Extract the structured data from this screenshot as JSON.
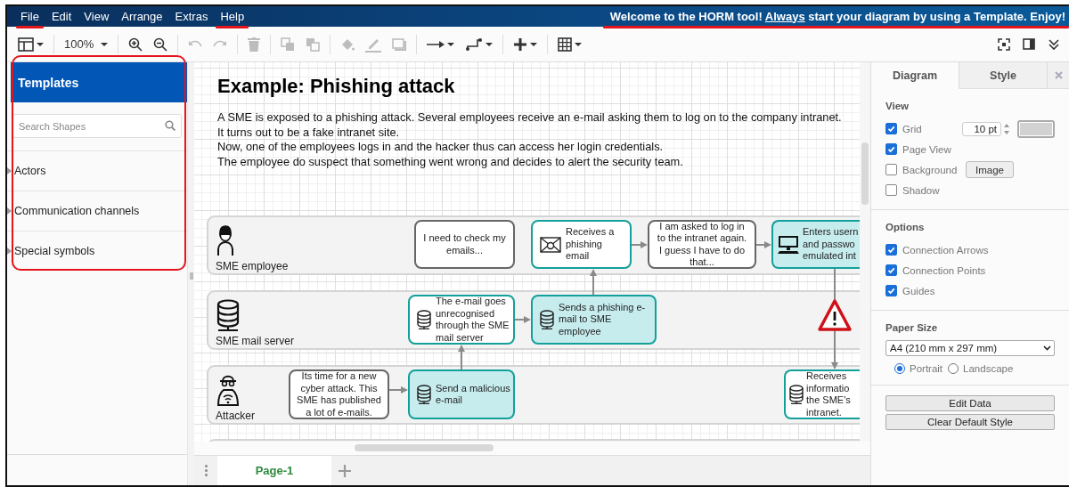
{
  "menubar": {
    "items": [
      {
        "label": "File",
        "highlighted": true
      },
      {
        "label": "Edit",
        "highlighted": false
      },
      {
        "label": "View",
        "highlighted": false
      },
      {
        "label": "Arrange",
        "highlighted": false
      },
      {
        "label": "Extras",
        "highlighted": false
      },
      {
        "label": "Help",
        "highlighted": true
      }
    ],
    "welcome": {
      "text_before": "Welcome to the HORM tool! ",
      "link": "Always",
      "text_after": " start your diagram by using a Template. Enjoy!",
      "highlighted": true
    }
  },
  "toolbar": {
    "groups": [
      [
        {
          "kind": "format",
          "dropdown": true,
          "disabled": false
        }
      ],
      [
        {
          "kind": "zoom",
          "label": "100%",
          "dropdown": true,
          "disabled": false
        }
      ],
      [
        {
          "kind": "zoom_in",
          "dropdown": false,
          "disabled": false
        },
        {
          "kind": "zoom_out",
          "dropdown": false,
          "disabled": false
        }
      ],
      [
        {
          "kind": "undo",
          "dropdown": false,
          "disabled": true
        },
        {
          "kind": "redo",
          "dropdown": false,
          "disabled": true
        }
      ],
      [
        {
          "kind": "delete",
          "dropdown": false,
          "disabled": true
        }
      ],
      [
        {
          "kind": "to_front",
          "dropdown": false,
          "disabled": true
        },
        {
          "kind": "to_back",
          "dropdown": false,
          "disabled": true
        }
      ],
      [
        {
          "kind": "fill",
          "dropdown": false,
          "disabled": true
        },
        {
          "kind": "line",
          "dropdown": false,
          "disabled": true
        },
        {
          "kind": "shadow",
          "dropdown": false,
          "disabled": true
        }
      ],
      [
        {
          "kind": "connection",
          "dropdown": true,
          "disabled": false
        },
        {
          "kind": "waypoints",
          "dropdown": true,
          "disabled": false
        }
      ],
      [
        {
          "kind": "insert",
          "dropdown": true,
          "disabled": false
        }
      ],
      [
        {
          "kind": "table",
          "dropdown": true,
          "disabled": false
        }
      ]
    ],
    "right": [
      {
        "kind": "fullscreen",
        "dropdown": false,
        "disabled": false
      },
      {
        "kind": "panel",
        "dropdown": false,
        "disabled": false
      },
      {
        "kind": "collapse",
        "dropdown": false,
        "disabled": false
      }
    ]
  },
  "sidebar": {
    "title": "Templates",
    "highlighted": true,
    "search": {
      "placeholder": "Search Shapes"
    },
    "sections": [
      {
        "label": "Actors",
        "expanded": false
      },
      {
        "label": "Communication channels",
        "expanded": false
      },
      {
        "label": "Special symbols",
        "expanded": false
      }
    ]
  },
  "diagram": {
    "title": "Example: Phishing attack",
    "description": "A SME is exposed to a phishing attack. Several employees receive an e-mail asking them to log on to the company intranet.\nIt turns out to be a fake intranet site.\nNow, one of the employees logs in and the hacker thus can access her login credentials.\nThe employee do suspect that something went wrong and decides to alert the security team.",
    "lanes": [
      {
        "label": "SME employee"
      },
      {
        "label": "SME mail server"
      },
      {
        "label": "Attacker"
      }
    ],
    "nodes": [
      {
        "kind": "note",
        "filled": false,
        "text": "I need to check my emails..."
      },
      {
        "kind": "message",
        "filled": false,
        "text": "Receives a phishing email"
      },
      {
        "kind": "note",
        "filled": false,
        "text": "I am asked to log in to the intranet again. I guess I have to do that..."
      },
      {
        "kind": "computer",
        "filled": true,
        "text": "Enters usern\nand passwo\nemulated int"
      },
      {
        "kind": "server",
        "filled": false,
        "text": "The e-mail goes unrecognised through the SME mail server"
      },
      {
        "kind": "server",
        "filled": true,
        "text": "Sends a phishing e-mail to SME employee"
      },
      {
        "kind": "note",
        "filled": false,
        "text": "Its time for a new cyber attack. This SME has published a lot of e-mails."
      },
      {
        "kind": "server",
        "filled": true,
        "text": "Send a malicious e-mail"
      },
      {
        "kind": "server",
        "filled": false,
        "text": "Receives\ninformatio\nthe SME's\nintranet."
      }
    ]
  },
  "pages": {
    "tabs": [
      {
        "label": "Page-1",
        "selected": true
      }
    ]
  },
  "format_panel": {
    "tabs": [
      {
        "label": "Diagram",
        "selected": true
      },
      {
        "label": "Style",
        "selected": false
      }
    ],
    "view": {
      "heading": "View",
      "grid_size": "10 pt",
      "image_button": "Image",
      "options": [
        {
          "label": "Grid",
          "checked": true
        },
        {
          "label": "Page View",
          "checked": true
        },
        {
          "label": "Background",
          "checked": false
        },
        {
          "label": "Shadow",
          "checked": false
        }
      ]
    },
    "options": {
      "heading": "Options",
      "items": [
        {
          "label": "Connection Arrows",
          "checked": true
        },
        {
          "label": "Connection Points",
          "checked": true
        },
        {
          "label": "Guides",
          "checked": true
        }
      ]
    },
    "paper": {
      "heading": "Paper Size",
      "value": "A4 (210 mm x 297 mm)",
      "orientations": [
        {
          "label": "Portrait",
          "selected": true
        },
        {
          "label": "Landscape",
          "selected": false
        }
      ]
    },
    "buttons": [
      "Edit Data",
      "Clear Default Style"
    ]
  }
}
